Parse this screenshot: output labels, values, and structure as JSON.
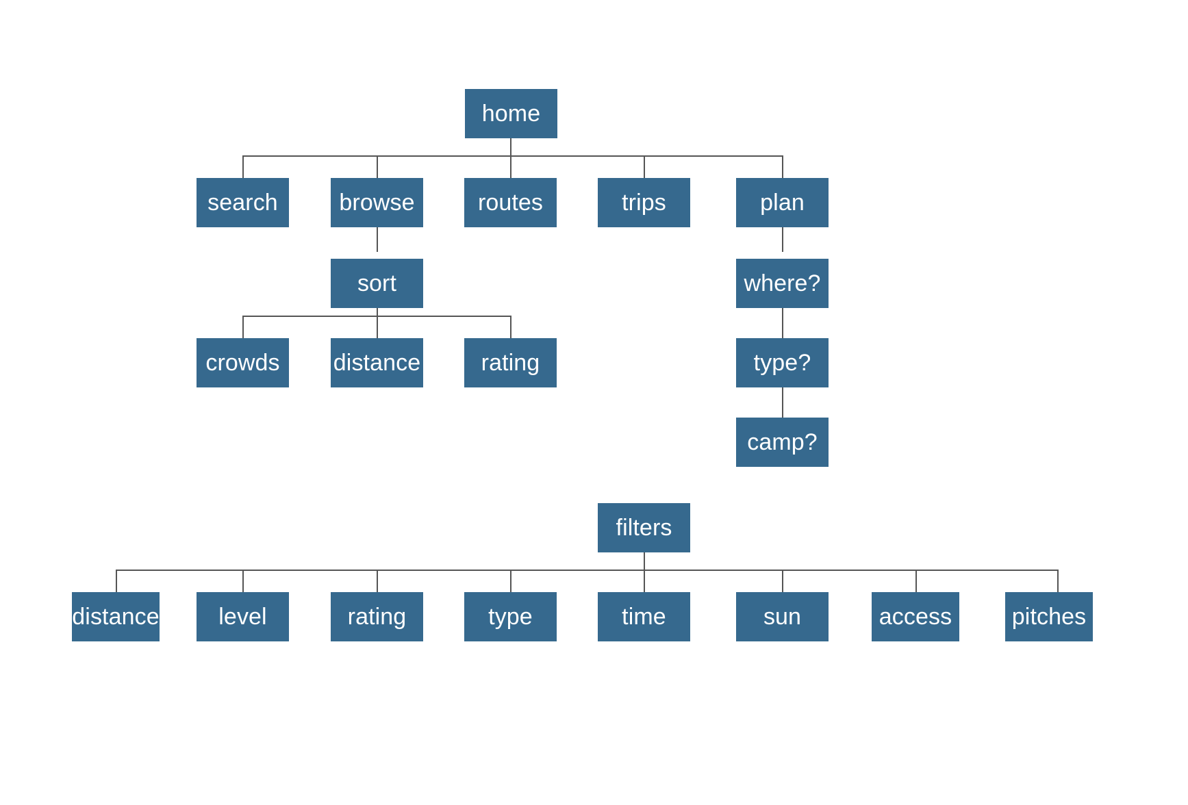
{
  "diagram": {
    "title": "sitemap",
    "type": "tree-diagram",
    "background_color": "#ffffff",
    "node_color": "#36698e",
    "node_text_color": "#ffffff",
    "edge_color": "#555555"
  },
  "trees": [
    {
      "name": "main-navigation-tree",
      "root": "home",
      "levels": [
        [
          "home"
        ],
        [
          "search",
          "browse",
          "routes",
          "trips",
          "plan"
        ],
        [
          "sort",
          "where?"
        ],
        [
          "crowds",
          "distance",
          "rating",
          "type?"
        ],
        [
          "camp?"
        ]
      ],
      "edges": [
        [
          "home",
          "search"
        ],
        [
          "home",
          "browse"
        ],
        [
          "home",
          "routes"
        ],
        [
          "home",
          "trips"
        ],
        [
          "home",
          "plan"
        ],
        [
          "browse",
          "sort"
        ],
        [
          "sort",
          "crowds"
        ],
        [
          "sort",
          "distance"
        ],
        [
          "sort",
          "rating"
        ],
        [
          "plan",
          "where?"
        ],
        [
          "where?",
          "type?"
        ],
        [
          "type?",
          "camp?"
        ]
      ]
    },
    {
      "name": "filters-tree",
      "root": "filters",
      "levels": [
        [
          "filters"
        ],
        [
          "distance",
          "level",
          "rating",
          "type",
          "time",
          "sun",
          "access",
          "pitches"
        ]
      ],
      "edges": [
        [
          "filters",
          "distance"
        ],
        [
          "filters",
          "level"
        ],
        [
          "filters",
          "rating"
        ],
        [
          "filters",
          "type"
        ],
        [
          "filters",
          "time"
        ],
        [
          "filters",
          "sun"
        ],
        [
          "filters",
          "access"
        ],
        [
          "filters",
          "pitches"
        ]
      ]
    }
  ],
  "nodes": {
    "home": {
      "label": "home"
    },
    "search": {
      "label": "search"
    },
    "browse": {
      "label": "browse"
    },
    "routes": {
      "label": "routes"
    },
    "trips": {
      "label": "trips"
    },
    "plan": {
      "label": "plan"
    },
    "sort": {
      "label": "sort"
    },
    "crowds": {
      "label": "crowds"
    },
    "sort_distance": {
      "label": "distance"
    },
    "sort_rating": {
      "label": "rating"
    },
    "where": {
      "label": "where?"
    },
    "type_q": {
      "label": "type?"
    },
    "camp": {
      "label": "camp?"
    },
    "filters": {
      "label": "filters"
    },
    "f_distance": {
      "label": "distance"
    },
    "f_level": {
      "label": "level"
    },
    "f_rating": {
      "label": "rating"
    },
    "f_type": {
      "label": "type"
    },
    "f_time": {
      "label": "time"
    },
    "f_sun": {
      "label": "sun"
    },
    "f_access": {
      "label": "access"
    },
    "f_pitches": {
      "label": "pitches"
    }
  }
}
